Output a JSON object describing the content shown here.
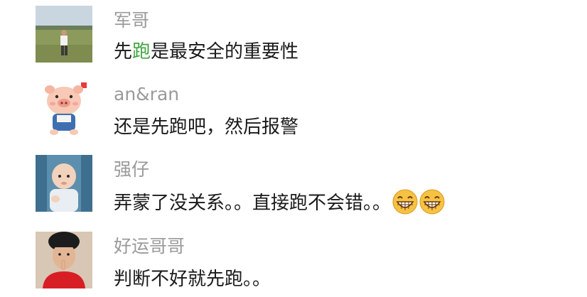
{
  "comments": [
    {
      "username": "军哥",
      "message_prefix": "先",
      "message_highlight": "跑",
      "message_suffix": "是最安全的重要性",
      "avatar_icon": "man-in-field-photo"
    },
    {
      "username": "an&ran",
      "message": "还是先跑吧，然后报警",
      "avatar_icon": "cartoon-pig-photo"
    },
    {
      "username": "强仔",
      "message": "弄蒙了没关系。。直接跑不会错。。",
      "emojis": [
        "grin-emoji",
        "grin-emoji"
      ],
      "avatar_icon": "baby-photo"
    },
    {
      "username": "好运哥哥",
      "message": "判断不好就先跑。。",
      "avatar_icon": "young-man-photo"
    }
  ],
  "colors": {
    "username": "#9a9a9a",
    "message": "#1a1a1a",
    "highlight": "#3fa63f"
  }
}
